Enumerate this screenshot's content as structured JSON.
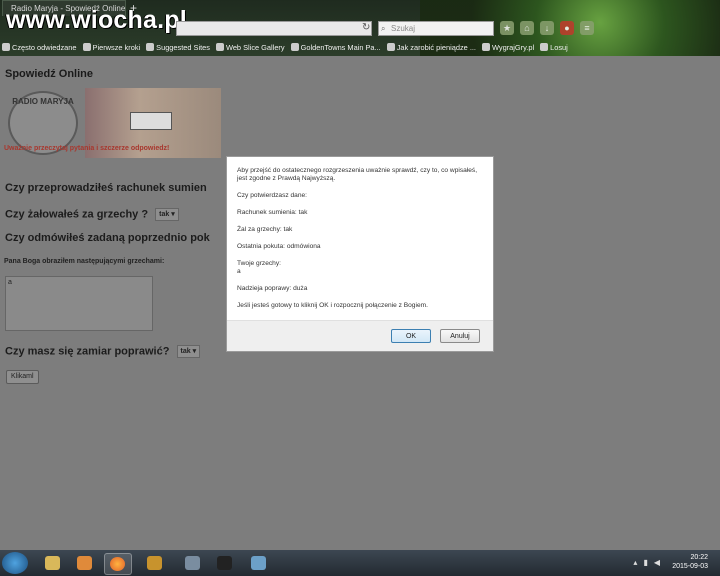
{
  "browser": {
    "tab_title": "Radio Maryja - Spowiedź Online",
    "new_tab": "+",
    "watermark": "www.wiocha.pl",
    "search_placeholder": "Szukaj",
    "bookmarks": [
      "Często odwiedzane",
      "Pierwsze kroki",
      "Suggested Sites",
      "Web Slice Gallery",
      "GoldenTowns Main Pa...",
      "Jak zarobić pieniądze ...",
      "WygrajGry.pl",
      "Losuj"
    ]
  },
  "page": {
    "title": "Spowiedź Online",
    "logo_text": "RADIO MARYJA",
    "warning": "Uważnie przeczytaj pytania i szczerze odpowiedz!",
    "q1": "Czy przeprowadziłeś rachunek sumien",
    "q2": "Czy żałowałeś za grzechy ?",
    "q2_select": "tak",
    "q3": "Czy odmówiłeś zadaną poprzednio pok",
    "sins_label": "Pana Boga obraziłem następującymi grzechami:",
    "sins_value": "a",
    "q4": "Czy masz się zamiar poprawić?",
    "q4_select": "tak",
    "submit": "Klikaml"
  },
  "modal": {
    "intro": "Aby przejść do ostatecznego rozgrzeszenia uważnie sprawdź, czy to, co wpisałeś, jest zgodne z Prawdą Najwyższą.",
    "confirm": "Czy potwierdzasz dane:",
    "line1": "Rachunek sumienia: tak",
    "line2": "Żal za grzechy: tak",
    "line3": "Ostatnia pokuta: odmówiona",
    "sins_title": "Twoje grzechy:",
    "sins_value": "a",
    "line5": "Nadzieja poprawy: duża",
    "outro": "Jeśli jesteś gotowy to kliknij OK i rozpocznij połączenie z Bogiem.",
    "ok": "OK",
    "cancel": "Anuluj"
  },
  "taskbar": {
    "time": "20:22",
    "date": "2015-09-03"
  }
}
